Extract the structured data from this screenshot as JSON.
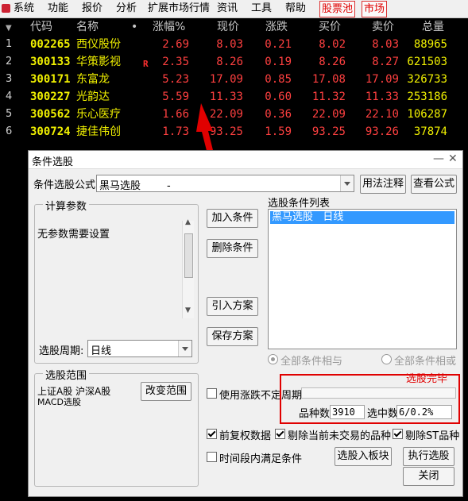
{
  "menu": [
    "系统",
    "功能",
    "报价",
    "分析",
    "扩展市场行情",
    "资讯",
    "工具",
    "帮助"
  ],
  "menu_tabs": [
    "股票池",
    "市场"
  ],
  "table": {
    "headers": [
      "代码",
      "名称",
      "•",
      "涨幅%",
      "现价",
      "涨跌",
      "买价",
      "卖价",
      "总量"
    ],
    "rows": [
      {
        "idx": "1",
        "code": "002265",
        "name": "西仪股份",
        "flag": "",
        "pct": "2.69",
        "price": "8.03",
        "chg": "0.21",
        "bid": "8.02",
        "ask": "8.03",
        "vol": "88965"
      },
      {
        "idx": "2",
        "code": "300133",
        "name": "华策影视",
        "flag": "R",
        "pct": "2.35",
        "price": "8.26",
        "chg": "0.19",
        "bid": "8.26",
        "ask": "8.27",
        "vol": "621503"
      },
      {
        "idx": "3",
        "code": "300171",
        "name": "东富龙",
        "flag": "",
        "pct": "5.23",
        "price": "17.09",
        "chg": "0.85",
        "bid": "17.08",
        "ask": "17.09",
        "vol": "326733"
      },
      {
        "idx": "4",
        "code": "300227",
        "name": "光韵达",
        "flag": "",
        "pct": "5.59",
        "price": "11.33",
        "chg": "0.60",
        "bid": "11.32",
        "ask": "11.33",
        "vol": "253186"
      },
      {
        "idx": "5",
        "code": "300562",
        "name": "乐心医疗",
        "flag": "",
        "pct": "1.66",
        "price": "22.09",
        "chg": "0.36",
        "bid": "22.09",
        "ask": "22.10",
        "vol": "106287"
      },
      {
        "idx": "6",
        "code": "300724",
        "name": "捷佳伟创",
        "flag": "",
        "pct": "1.73",
        "price": "93.25",
        "chg": "1.59",
        "bid": "93.25",
        "ask": "93.26",
        "vol": "37874"
      }
    ]
  },
  "dialog": {
    "title": "条件选股",
    "formula_label": "条件选股公式",
    "formula_value": "黑马选股        -",
    "usage_button": "用法注释",
    "view_formula_button": "查看公式",
    "params_group": "计算参数",
    "params_text": "无参数需要设置",
    "period_label": "选股周期:",
    "period_value": "日线",
    "range_group": "选股范围",
    "range_line1": "上证A股  沪深A股",
    "range_line2": "MACD选股",
    "change_range_button": "改变范围",
    "add_condition_button": "加入条件",
    "delete_condition_button": "删除条件",
    "import_plan_button": "引入方案",
    "save_plan_button": "保存方案",
    "condition_list_label": "选股条件列表",
    "condition_item": "黑马选股   日线",
    "radio_and": "全部条件相与",
    "radio_or": "全部条件相或",
    "use_undetermined": "使用涨跌不定周期",
    "count_label": "品种数",
    "count_value": "3910",
    "selected_label": "选中数",
    "selected_value": "6/0.2%",
    "done_text": "选股完毕",
    "forward_adjust": "前复权数据",
    "exclude_untraded": "剔除当前未交易的品种",
    "exclude_st": "剔除ST品种",
    "time_condition": "时间段内满足条件",
    "to_block_button": "选股入板块",
    "execute_button": "执行选股",
    "close_button": "关闭"
  },
  "colors": {
    "up": "#ff4040",
    "code": "#f0f000",
    "annotation": "#e00000"
  }
}
